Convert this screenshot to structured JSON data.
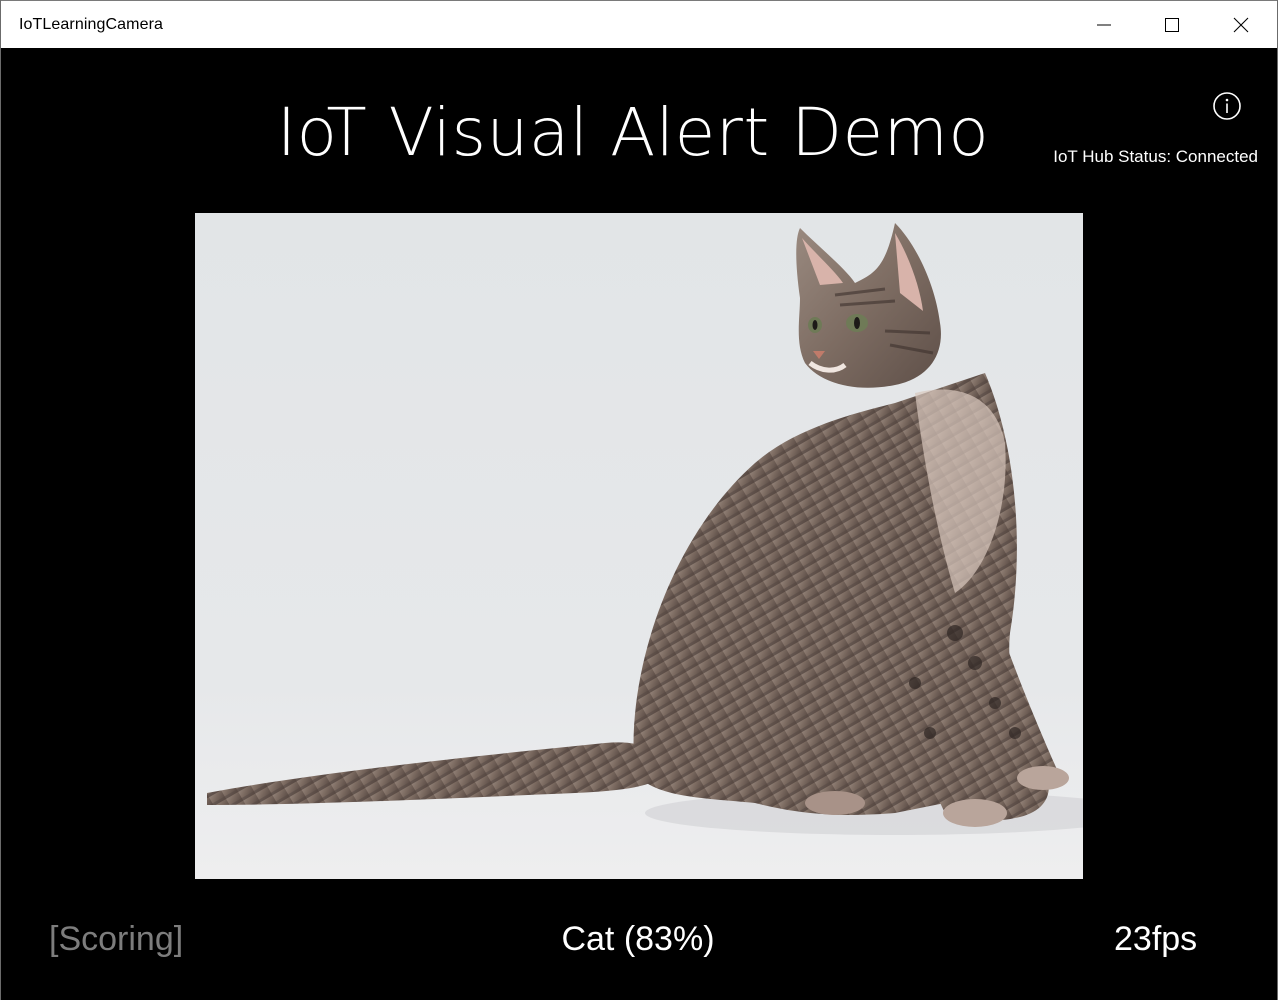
{
  "window": {
    "title": "IoTLearningCamera",
    "controls": {
      "minimize_icon": "minimize-icon",
      "maximize_icon": "maximize-icon",
      "close_icon": "close-icon"
    }
  },
  "header": {
    "title": "IoT Visual Alert Demo",
    "info_icon": "info-icon",
    "hub_status": "IoT Hub Status: Connected"
  },
  "camera": {
    "subject": "cat-photo"
  },
  "footer": {
    "scoring_label": "[Scoring]",
    "prediction": "Cat (83%)",
    "fps": "23fps"
  },
  "colors": {
    "background": "#000000",
    "titlebar": "#ffffff",
    "text_primary": "#ffffff",
    "text_muted": "#7d7d7d"
  }
}
